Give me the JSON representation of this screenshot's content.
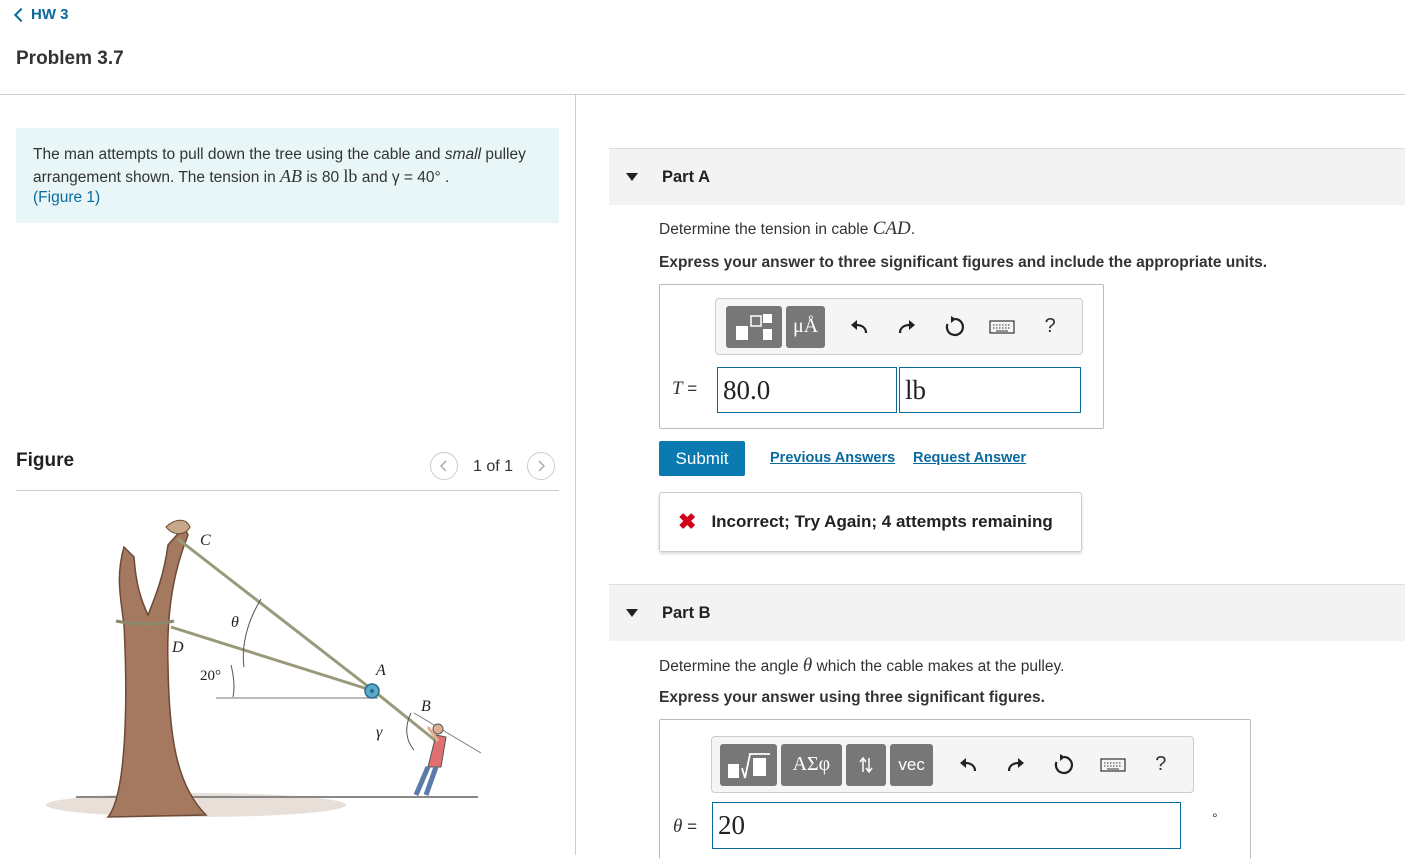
{
  "nav": {
    "back_label": "HW 3"
  },
  "problem": {
    "title": "Problem 3.7"
  },
  "intro": {
    "text_1": "The man attempts to pull down the tree using the cable and ",
    "text_italic": "small",
    "text_2": " pulley arrangement shown. The tension in ",
    "var_AB": "AB",
    "text_3": " is 80 ",
    "unit_lb": "lb",
    "text_4": " and γ = 40° .",
    "figure_link": "(Figure 1)"
  },
  "figure": {
    "heading": "Figure",
    "pager": "1 of 1",
    "labels": {
      "C": "C",
      "D": "D",
      "A": "A",
      "B": "B",
      "theta": "θ",
      "gamma": "γ",
      "angle20": "20°"
    }
  },
  "part_a": {
    "header": "Part A",
    "question_prefix": "Determine the tension in cable ",
    "question_var": "CAD",
    "question_suffix": ".",
    "instruction": "Express your answer to three significant figures and include the appropriate units.",
    "toolbar": {
      "units_label": "μÅ",
      "help_label": "?"
    },
    "answer_var": "T",
    "answer_eq": " =",
    "value": "80.0",
    "units": "lb",
    "submit_label": "Submit",
    "previous_answers_label": "Previous Answers",
    "request_answer_label": "Request Answer",
    "feedback": "Incorrect; Try Again; 4 attempts remaining"
  },
  "part_b": {
    "header": "Part B",
    "question_prefix": "Determine the angle ",
    "question_var": "θ",
    "question_suffix": " which the cable makes at the pulley.",
    "instruction": "Express your answer using three significant figures.",
    "toolbar": {
      "greek_label": "ΑΣφ",
      "vec_label": "vec",
      "help_label": "?"
    },
    "answer_var": "θ",
    "answer_eq": " =",
    "value": "20",
    "unit_symbol": "°"
  }
}
